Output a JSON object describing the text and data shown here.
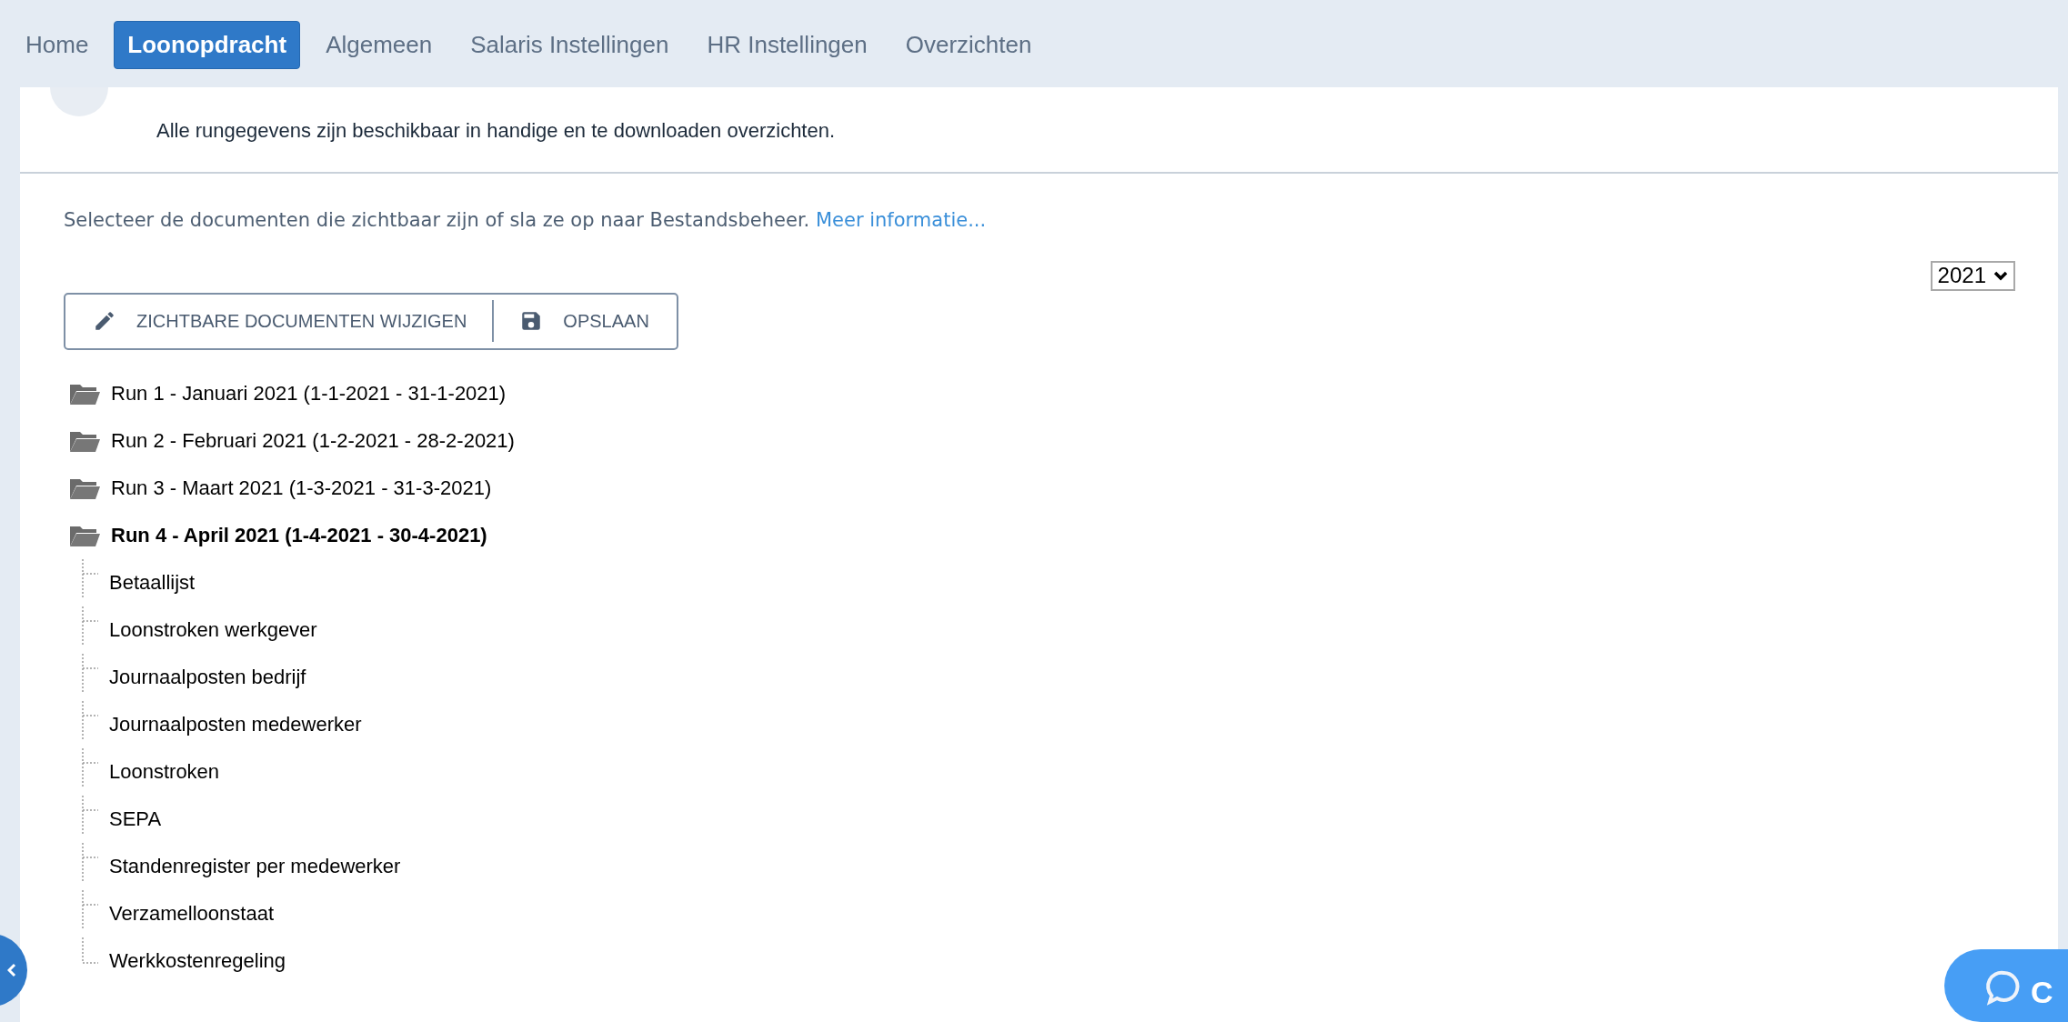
{
  "nav": {
    "tabs": [
      {
        "label": "Home",
        "selected": false
      },
      {
        "label": "Loonopdracht",
        "selected": true
      },
      {
        "label": "Algemeen",
        "selected": false
      },
      {
        "label": "Salaris Instellingen",
        "selected": false
      },
      {
        "label": "HR Instellingen",
        "selected": false
      },
      {
        "label": "Overzichten",
        "selected": false
      }
    ]
  },
  "header": {
    "description": "Alle rungegevens zijn beschikbaar in handige en te downloaden overzichten."
  },
  "intro": {
    "text": "Selecteer de documenten die zichtbaar zijn of sla ze op naar Bestandsbeheer.",
    "link": "Meer informatie..."
  },
  "year_select": {
    "value": "2021"
  },
  "toolbar": {
    "buttons": [
      {
        "label": "ZICHTBARE DOCUMENTEN WIJZIGEN",
        "kind": "edit"
      },
      {
        "label": "OPSLAAN",
        "kind": "save"
      }
    ]
  },
  "tree": [
    {
      "label": "Run 1 - Januari 2021 (1-1-2021 - 31-1-2021)",
      "expanded": false
    },
    {
      "label": "Run 2 - Februari 2021 (1-2-2021 - 28-2-2021)",
      "expanded": false
    },
    {
      "label": "Run 3 - Maart 2021 (1-3-2021 - 31-3-2021)",
      "expanded": false
    },
    {
      "label": "Run 4 - April 2021 (1-4-2021 - 30-4-2021)",
      "expanded": true,
      "children": [
        {
          "label": "Betaallijst"
        },
        {
          "label": "Loonstroken werkgever"
        },
        {
          "label": "Journaalposten bedrijf"
        },
        {
          "label": "Journaalposten medewerker"
        },
        {
          "label": "Loonstroken"
        },
        {
          "label": "SEPA"
        },
        {
          "label": "Standenregister per medewerker"
        },
        {
          "label": "Verzamelloonstaat"
        },
        {
          "label": "Werkkostenregeling"
        }
      ]
    }
  ],
  "chat_button": {
    "label": "C"
  }
}
